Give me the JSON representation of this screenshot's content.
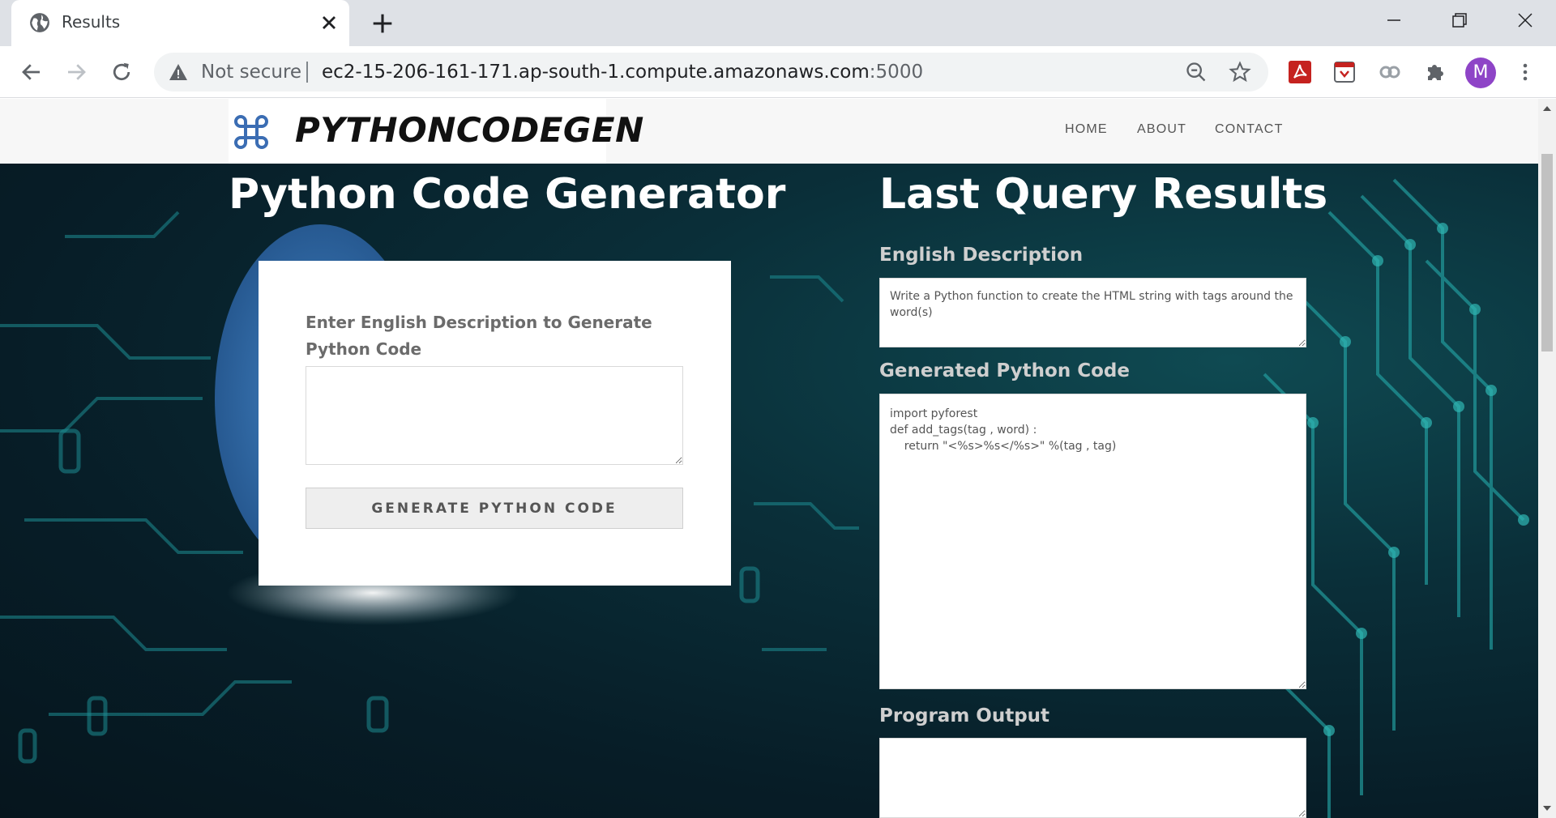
{
  "browser": {
    "tab_title": "Results",
    "omnibox": {
      "security_text": "Not secure",
      "url_host": "ec2-15-206-161-171.ap-south-1.compute.amazonaws.com",
      "url_port": ":5000"
    },
    "profile_initial": "M",
    "icons": [
      "globe-icon",
      "close-icon",
      "plus-icon",
      "minimize-icon",
      "restore-icon",
      "window-close-icon",
      "back-icon",
      "forward-icon",
      "reload-icon",
      "warning-icon",
      "zoom-out-icon",
      "star-icon",
      "pdf-extension-icon",
      "shield-extension-icon",
      "glasses-extension-icon",
      "puzzle-icon",
      "menu-dots-icon"
    ]
  },
  "site": {
    "logo_text": "PYTHONCODEGEN",
    "nav": [
      "HOME",
      "ABOUT",
      "CONTACT"
    ],
    "accent_color": "#0a2f39"
  },
  "generator": {
    "title": "Python Code Generator",
    "label": "Enter English Description to Generate Python Code",
    "input_value": "",
    "button": "GENERATE PYTHON CODE"
  },
  "results": {
    "title": "Last Query Results",
    "description_label": "English Description",
    "description_value": "Write a Python function to create the HTML string with tags around the word(s)",
    "code_label": "Generated Python Code",
    "code_value": "import pyforest\ndef add_tags(tag , word) :\n    return \"<%s>%s</%s>\" %(tag , tag)",
    "output_label": "Program Output",
    "output_value": ""
  }
}
